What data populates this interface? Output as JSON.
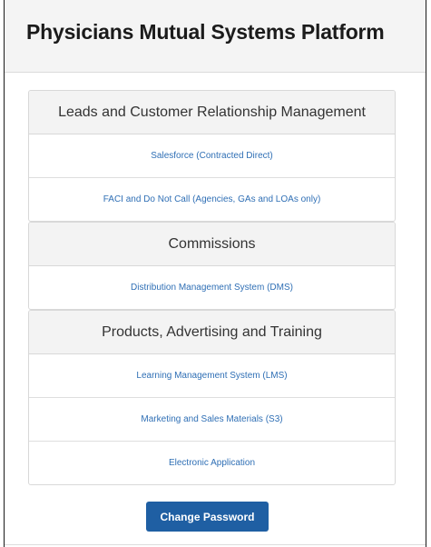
{
  "header": {
    "title": "Physicians Mutual Systems Platform"
  },
  "groups": [
    {
      "heading": "Leads and Customer Relationship Management",
      "items": [
        "Salesforce (Contracted Direct)",
        "FACI and Do Not Call (Agencies, GAs and LOAs only)"
      ]
    },
    {
      "heading": "Commissions",
      "items": [
        "Distribution Management System (DMS)"
      ]
    },
    {
      "heading": "Products, Advertising and Training",
      "items": [
        "Learning Management System (LMS)",
        "Marketing and Sales Materials (S3)",
        "Electronic Application"
      ]
    }
  ],
  "actions": {
    "change_password_label": "Change Password"
  },
  "colors": {
    "link": "#2f6fb5",
    "button": "#1f5fa3",
    "header_bg": "#f4f4f4"
  }
}
